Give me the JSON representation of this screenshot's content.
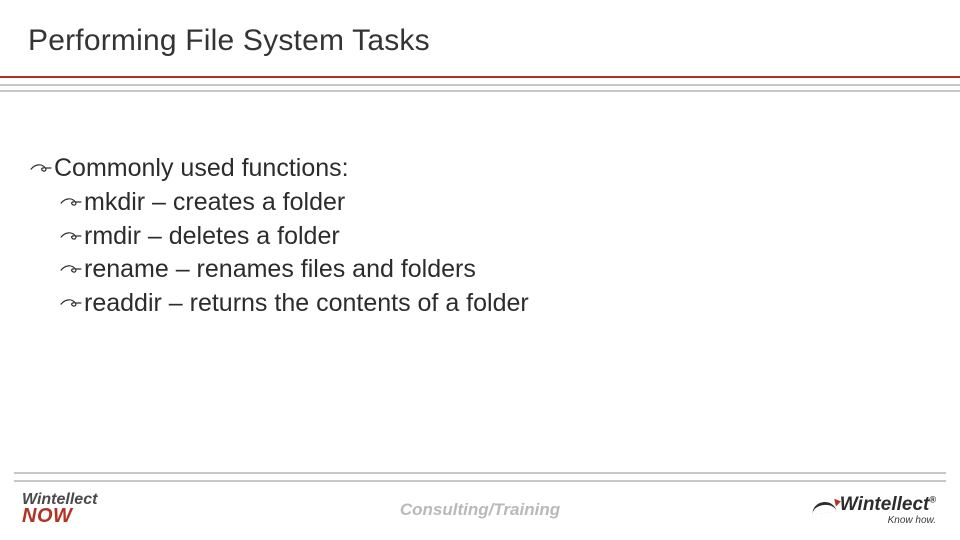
{
  "title": "Performing File System Tasks",
  "bullets": {
    "heading": "Commonly used functions:",
    "items": [
      "mkdir – creates a folder",
      "rmdir – deletes a folder",
      "rename – renames files and folders",
      "readdir – returns the contents of a folder"
    ]
  },
  "footer": {
    "logo_left_top": "Wintellect",
    "logo_left_bottom": "NOW",
    "center": "Consulting/Training",
    "logo_right_brand": "Wintellect",
    "logo_right_reg": "®",
    "logo_right_tag": "Know how."
  },
  "icons": {
    "bullet": "swirl-icon"
  }
}
